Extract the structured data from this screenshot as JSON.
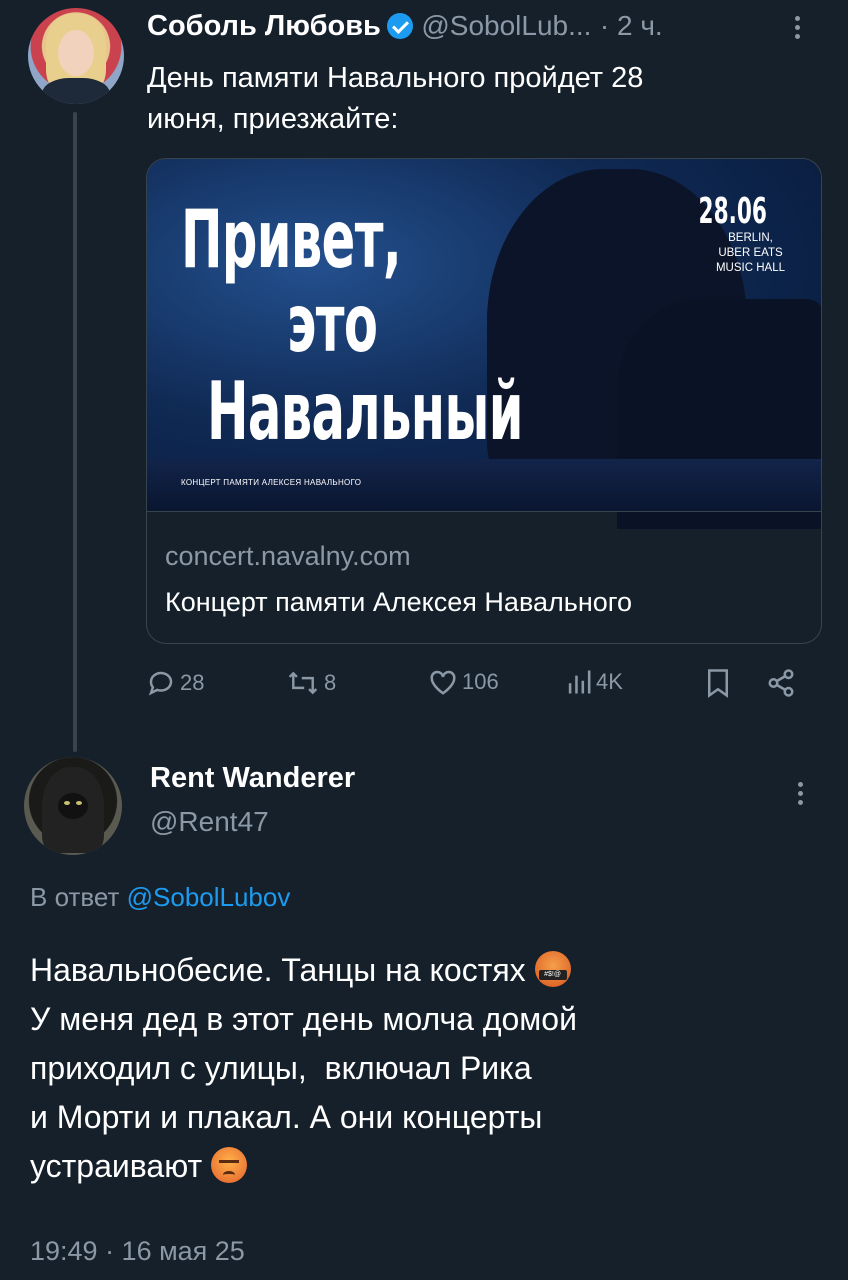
{
  "tweet": {
    "author_name": "Соболь Любовь",
    "handle": "@SobolLub...",
    "time": "· 2 ч.",
    "text_line1": "День памяти Навального пройдет 28",
    "text_line2": "июня, приезжайте:",
    "card": {
      "poster_line1": "Привет,",
      "poster_line2": "это",
      "poster_line3": "Навальный",
      "poster_date": "28.06",
      "poster_venue_line1": "BERLIN,",
      "poster_venue_line2": "UBER EATS",
      "poster_venue_line3": "MUSIC HALL",
      "poster_subtitle": "КОНЦЕРТ ПАМЯТИ АЛЕКСЕЯ НАВАЛЬНОГО",
      "domain": "concert.navalny.com",
      "title": "Концерт памяти Алексея Навального"
    },
    "actions": {
      "replies": "28",
      "retweets": "8",
      "likes": "106",
      "views": "4K"
    }
  },
  "reply": {
    "author_name": "Rent Wanderer",
    "handle": "@Rent47",
    "reply_prefix": "В ответ",
    "reply_to": "@SobolLubov",
    "line1": "Навальнобесие. Танцы на костях",
    "line2": "У меня дед в этот день молча домой",
    "line3": "приходил с улицы,  включал Рика",
    "line4": "и Морти и плакал. А они концерты",
    "line5": "устраивают",
    "timestamp": "19:49 · 16 мая 25"
  },
  "colors": {
    "background": "#15202b",
    "accent": "#1d9bf0",
    "muted": "#8b98a5"
  },
  "icons": [
    "kebab-menu-icon",
    "verified-badge-icon",
    "reply-icon",
    "retweet-icon",
    "like-icon",
    "views-icon",
    "bookmark-icon",
    "share-icon",
    "face-with-symbols-emoji",
    "angry-face-emoji"
  ]
}
